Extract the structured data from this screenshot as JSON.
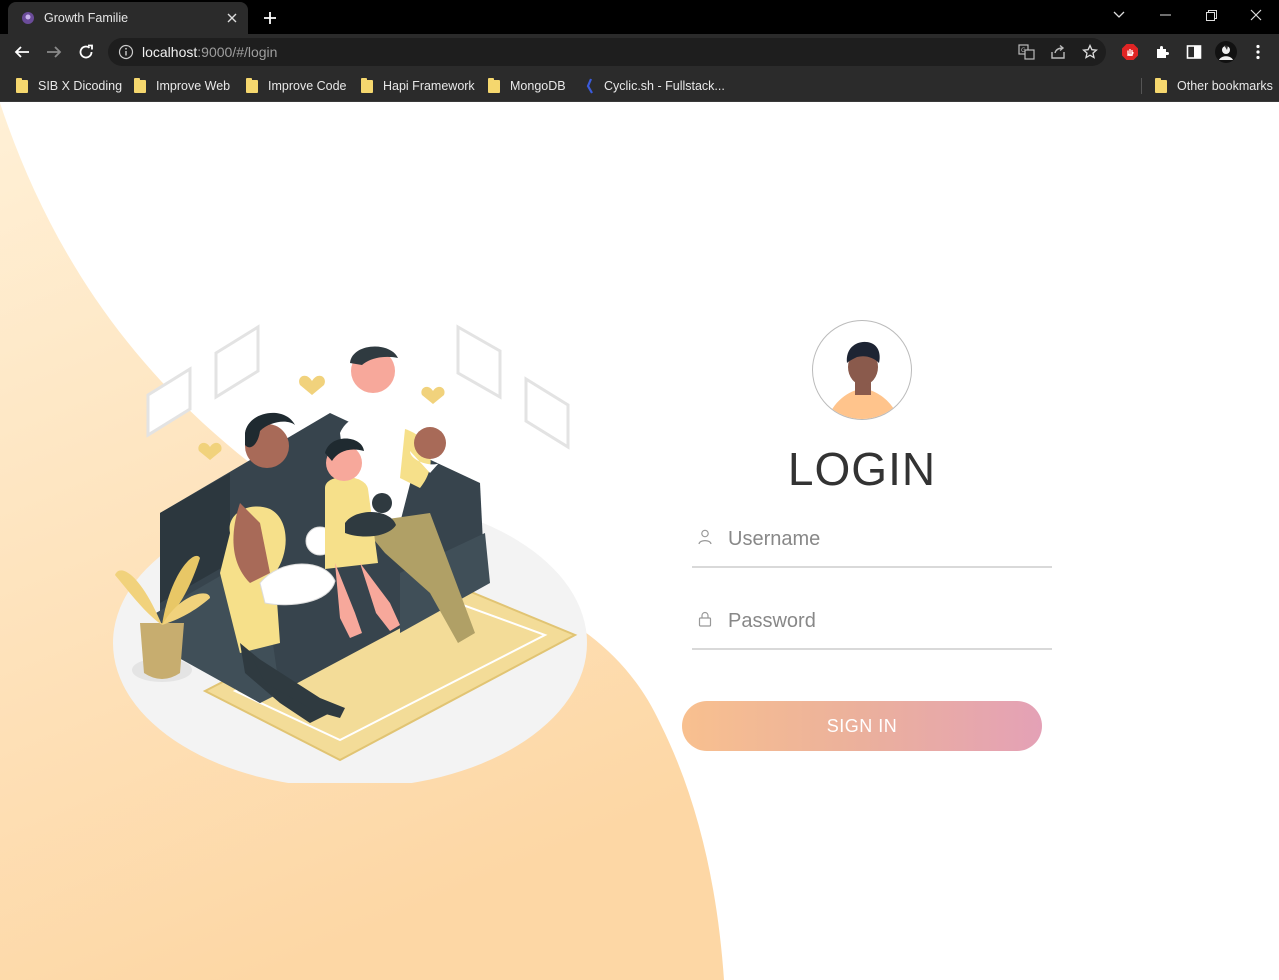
{
  "browser": {
    "tab_title": "Growth Familie",
    "url_host": "localhost",
    "url_rest": ":9000/#/login",
    "bookmarks": [
      {
        "label": "SIB X Dicoding",
        "icon": "folder-icon"
      },
      {
        "label": "Improve Web",
        "icon": "folder-icon"
      },
      {
        "label": "Improve Code",
        "icon": "folder-icon"
      },
      {
        "label": "Hapi Framework",
        "icon": "folder-icon"
      },
      {
        "label": "MongoDB",
        "icon": "folder-icon"
      },
      {
        "label": "Cyclic.sh - Fullstack...",
        "icon": "cyclic-icon"
      }
    ],
    "other_bookmarks": "Other bookmarks"
  },
  "login": {
    "title": "LOGIN",
    "username_placeholder": "Username",
    "password_placeholder": "Password",
    "signin_label": "SIGN IN"
  },
  "colors": {
    "wave_light": "#fff0d6",
    "wave_dark": "#fdd7a5",
    "button_start": "#f8c08f",
    "button_end": "#e4a1b6"
  }
}
